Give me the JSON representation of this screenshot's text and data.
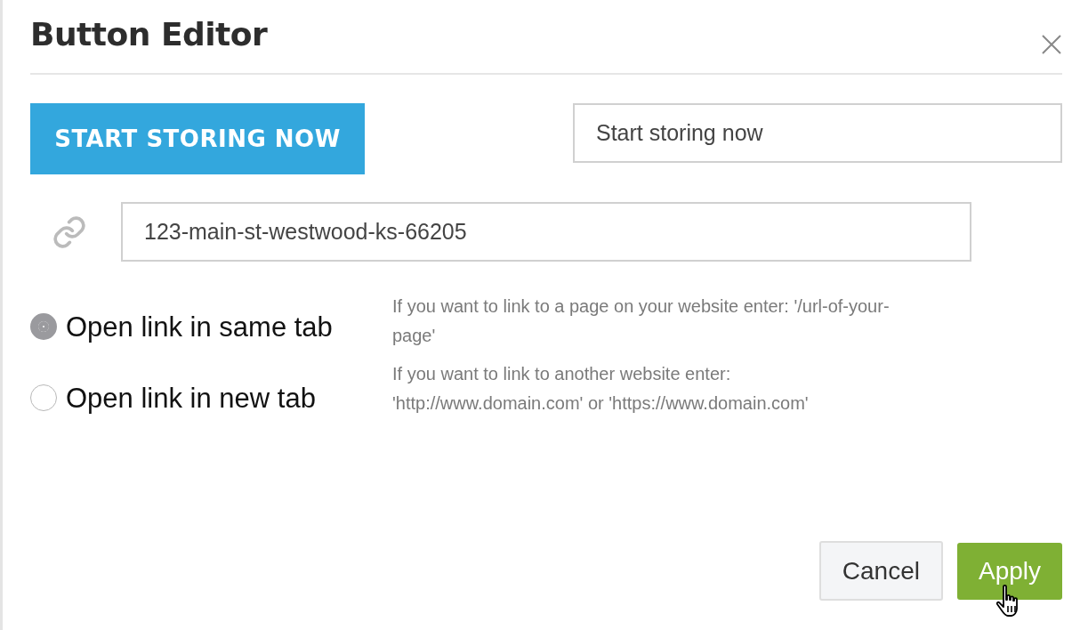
{
  "dialog": {
    "title": "Button Editor"
  },
  "preview_button": {
    "label": "START STORING NOW"
  },
  "label_field": {
    "value": "Start storing now"
  },
  "link_field": {
    "value": "123-main-st-westwood-ks-66205"
  },
  "link_targets": [
    {
      "label": "Open link in same tab",
      "selected": true
    },
    {
      "label": "Open link in new tab",
      "selected": false
    }
  ],
  "help": [
    "If you want to link to a page on your website enter: '/url-of-your-page'",
    "If you want to link to another website enter: 'http://www.domain.com' or 'https://www.domain.com'"
  ],
  "buttons": [
    {
      "kind": "secondary",
      "label": "Cancel"
    },
    {
      "kind": "primary",
      "label": "Apply"
    }
  ]
}
